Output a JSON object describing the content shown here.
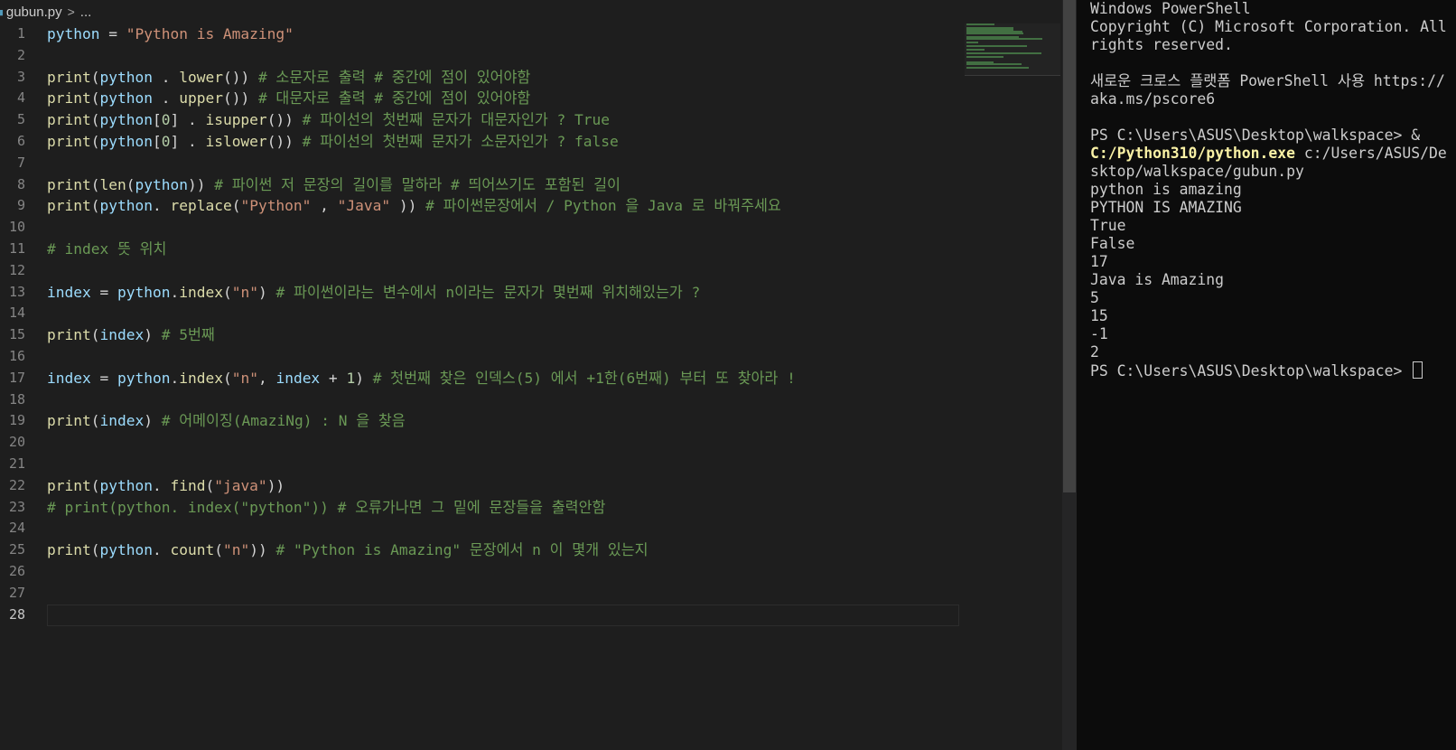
{
  "breadcrumb": {
    "file": "gubun.py",
    "chevron": ">",
    "more": "..."
  },
  "code": [
    {
      "n": "1",
      "tokens": [
        [
          "v",
          "python"
        ],
        [
          "p",
          " = "
        ],
        [
          "s",
          "\"Python is Amazing\""
        ]
      ]
    },
    {
      "n": "2",
      "tokens": []
    },
    {
      "n": "3",
      "tokens": [
        [
          "f",
          "print"
        ],
        [
          "p",
          "("
        ],
        [
          "v",
          "python"
        ],
        [
          "p",
          " . "
        ],
        [
          "f",
          "lower"
        ],
        [
          "p",
          "()) "
        ],
        [
          "c",
          "# 소문자로 출력 # 중간에 점이 있어야함"
        ]
      ]
    },
    {
      "n": "4",
      "tokens": [
        [
          "f",
          "print"
        ],
        [
          "p",
          "("
        ],
        [
          "v",
          "python"
        ],
        [
          "p",
          " . "
        ],
        [
          "f",
          "upper"
        ],
        [
          "p",
          "()) "
        ],
        [
          "c",
          "# 대문자로 출력 # 중간에 점이 있어야함"
        ]
      ]
    },
    {
      "n": "5",
      "tokens": [
        [
          "f",
          "print"
        ],
        [
          "p",
          "("
        ],
        [
          "v",
          "python"
        ],
        [
          "p",
          "["
        ],
        [
          "n",
          "0"
        ],
        [
          "p",
          "] . "
        ],
        [
          "f",
          "isupper"
        ],
        [
          "p",
          "()) "
        ],
        [
          "c",
          "# 파이선의 첫번째 문자가 대문자인가 ? True"
        ]
      ]
    },
    {
      "n": "6",
      "tokens": [
        [
          "f",
          "print"
        ],
        [
          "p",
          "("
        ],
        [
          "v",
          "python"
        ],
        [
          "p",
          "["
        ],
        [
          "n",
          "0"
        ],
        [
          "p",
          "] . "
        ],
        [
          "f",
          "islower"
        ],
        [
          "p",
          "()) "
        ],
        [
          "c",
          "# 파이선의 첫번째 문자가 소문자인가 ? false"
        ]
      ]
    },
    {
      "n": "7",
      "tokens": []
    },
    {
      "n": "8",
      "tokens": [
        [
          "f",
          "print"
        ],
        [
          "p",
          "("
        ],
        [
          "f",
          "len"
        ],
        [
          "p",
          "("
        ],
        [
          "v",
          "python"
        ],
        [
          "p",
          ")) "
        ],
        [
          "c",
          "# 파이썬 저 문장의 길이를 말하라 # 띄어쓰기도 포함된 길이"
        ]
      ]
    },
    {
      "n": "9",
      "tokens": [
        [
          "f",
          "print"
        ],
        [
          "p",
          "("
        ],
        [
          "v",
          "python"
        ],
        [
          "p",
          ". "
        ],
        [
          "f",
          "replace"
        ],
        [
          "p",
          "("
        ],
        [
          "s",
          "\"Python\""
        ],
        [
          "p",
          " , "
        ],
        [
          "s",
          "\"Java\""
        ],
        [
          "p",
          " )) "
        ],
        [
          "c",
          "# 파이썬문장에서 / Python 을 Java 로 바꿔주세요"
        ]
      ]
    },
    {
      "n": "10",
      "tokens": []
    },
    {
      "n": "11",
      "tokens": [
        [
          "c",
          "# index 뜻 위치"
        ]
      ]
    },
    {
      "n": "12",
      "tokens": []
    },
    {
      "n": "13",
      "tokens": [
        [
          "v",
          "index"
        ],
        [
          "p",
          " = "
        ],
        [
          "v",
          "python"
        ],
        [
          "p",
          "."
        ],
        [
          "f",
          "index"
        ],
        [
          "p",
          "("
        ],
        [
          "s",
          "\"n\""
        ],
        [
          "p",
          ") "
        ],
        [
          "c",
          "# 파이썬이라는 변수에서 n이라는 문자가 몇번째 위치해있는가 ?"
        ]
      ]
    },
    {
      "n": "14",
      "tokens": []
    },
    {
      "n": "15",
      "tokens": [
        [
          "f",
          "print"
        ],
        [
          "p",
          "("
        ],
        [
          "v",
          "index"
        ],
        [
          "p",
          ") "
        ],
        [
          "c",
          "# 5번째"
        ]
      ]
    },
    {
      "n": "16",
      "tokens": []
    },
    {
      "n": "17",
      "tokens": [
        [
          "v",
          "index"
        ],
        [
          "p",
          " = "
        ],
        [
          "v",
          "python"
        ],
        [
          "p",
          "."
        ],
        [
          "f",
          "index"
        ],
        [
          "p",
          "("
        ],
        [
          "s",
          "\"n\""
        ],
        [
          "p",
          ", "
        ],
        [
          "v",
          "index"
        ],
        [
          "p",
          " + "
        ],
        [
          "n",
          "1"
        ],
        [
          "p",
          ") "
        ],
        [
          "c",
          "# 첫번째 찾은 인덱스(5) 에서 +1한(6번째) 부터 또 찾아라 !"
        ]
      ]
    },
    {
      "n": "18",
      "tokens": []
    },
    {
      "n": "19",
      "tokens": [
        [
          "f",
          "print"
        ],
        [
          "p",
          "("
        ],
        [
          "v",
          "index"
        ],
        [
          "p",
          ") "
        ],
        [
          "c",
          "# 어메이징(AmaziNg) : N 을 찾음"
        ]
      ]
    },
    {
      "n": "20",
      "tokens": []
    },
    {
      "n": "21",
      "tokens": []
    },
    {
      "n": "22",
      "tokens": [
        [
          "f",
          "print"
        ],
        [
          "p",
          "("
        ],
        [
          "v",
          "python"
        ],
        [
          "p",
          ". "
        ],
        [
          "f",
          "find"
        ],
        [
          "p",
          "("
        ],
        [
          "s",
          "\"java\""
        ],
        [
          "p",
          "))"
        ]
      ]
    },
    {
      "n": "23",
      "tokens": [
        [
          "c",
          "# print(python. index(\"python\")) # 오류가나면 그 밑에 문장들을 출력안함"
        ]
      ]
    },
    {
      "n": "24",
      "tokens": []
    },
    {
      "n": "25",
      "tokens": [
        [
          "f",
          "print"
        ],
        [
          "p",
          "("
        ],
        [
          "v",
          "python"
        ],
        [
          "p",
          ". "
        ],
        [
          "f",
          "count"
        ],
        [
          "p",
          "("
        ],
        [
          "s",
          "\"n\""
        ],
        [
          "p",
          ")) "
        ],
        [
          "c",
          "# \"Python is Amazing\" 문장에서 n 이 몇개 있는지"
        ]
      ]
    },
    {
      "n": "26",
      "tokens": []
    },
    {
      "n": "27",
      "tokens": []
    },
    {
      "n": "28",
      "tokens": [],
      "active": true
    }
  ],
  "terminal": [
    {
      "text": "Windows PowerShell"
    },
    {
      "text": "Copyright (C) Microsoft Corporation. All rights reserved."
    },
    {
      "text": ""
    },
    {
      "text": "새로운 크로스 플랫폼 PowerShell 사용 https://aka.ms/pscore6"
    },
    {
      "text": ""
    },
    {
      "prompt": "PS C:\\Users\\ASUS\\Desktop\\walkspace> ",
      "op": "& ",
      "exe": "C:/Python310/python.exe",
      "arg": " c:/Users/ASUS/Desktop/walkspace/gubun.py"
    },
    {
      "text": "python is amazing"
    },
    {
      "text": "PYTHON IS AMAZING"
    },
    {
      "text": "True"
    },
    {
      "text": "False"
    },
    {
      "text": "17"
    },
    {
      "text": "Java is Amazing"
    },
    {
      "text": "5"
    },
    {
      "text": "15"
    },
    {
      "text": "-1"
    },
    {
      "text": "2"
    },
    {
      "prompt": "PS C:\\Users\\ASUS\\Desktop\\walkspace> ",
      "cursor": true
    }
  ],
  "colors": {
    "editor_bg": "#1e1e1e",
    "terminal_bg": "#0c0c0c",
    "comment": "#6a9955",
    "string": "#ce9178",
    "function": "#dcdcaa",
    "variable": "#9cdcfe",
    "number": "#b5cea8",
    "terminal_exe": "#f9f1a5"
  },
  "icons": {
    "file_icon": "python-file-icon",
    "chevron": "chevron-right-icon"
  }
}
